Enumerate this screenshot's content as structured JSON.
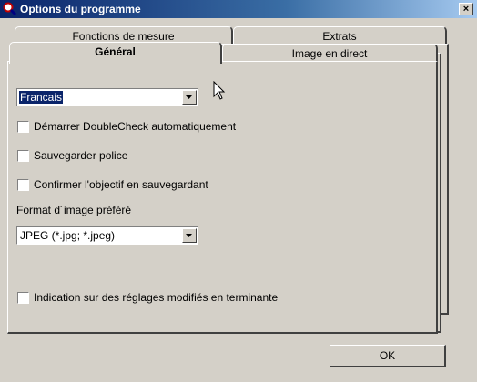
{
  "window": {
    "title": "Options du programme",
    "close_label": "×"
  },
  "tabs": {
    "fonctions": "Fonctions de mesure",
    "extrats": "Extrats",
    "general": "Général",
    "image": "Image en direct"
  },
  "general": {
    "language_value": "Francais",
    "checkboxes": [
      {
        "label": "Démarrer DoubleCheck automatiquement",
        "checked": false
      },
      {
        "label": "Sauvegarder police",
        "checked": false
      },
      {
        "label": "Confirmer l'objectif en sauvegardant",
        "checked": false
      }
    ],
    "format_label": "Format d´image préféré",
    "format_value": "JPEG (*.jpg; *.jpeg)",
    "end_checkbox": {
      "label": "Indication sur des réglages modifiés en terminante",
      "checked": false
    }
  },
  "buttons": {
    "ok": "OK"
  },
  "colors": {
    "face": "#d4d0c8",
    "titlebar": "#0a246a",
    "selection": "#0a246a"
  },
  "icons": {
    "app": "magnifier-icon",
    "dropdown": "chevron-down-icon",
    "cursor": "mouse-pointer-icon"
  }
}
